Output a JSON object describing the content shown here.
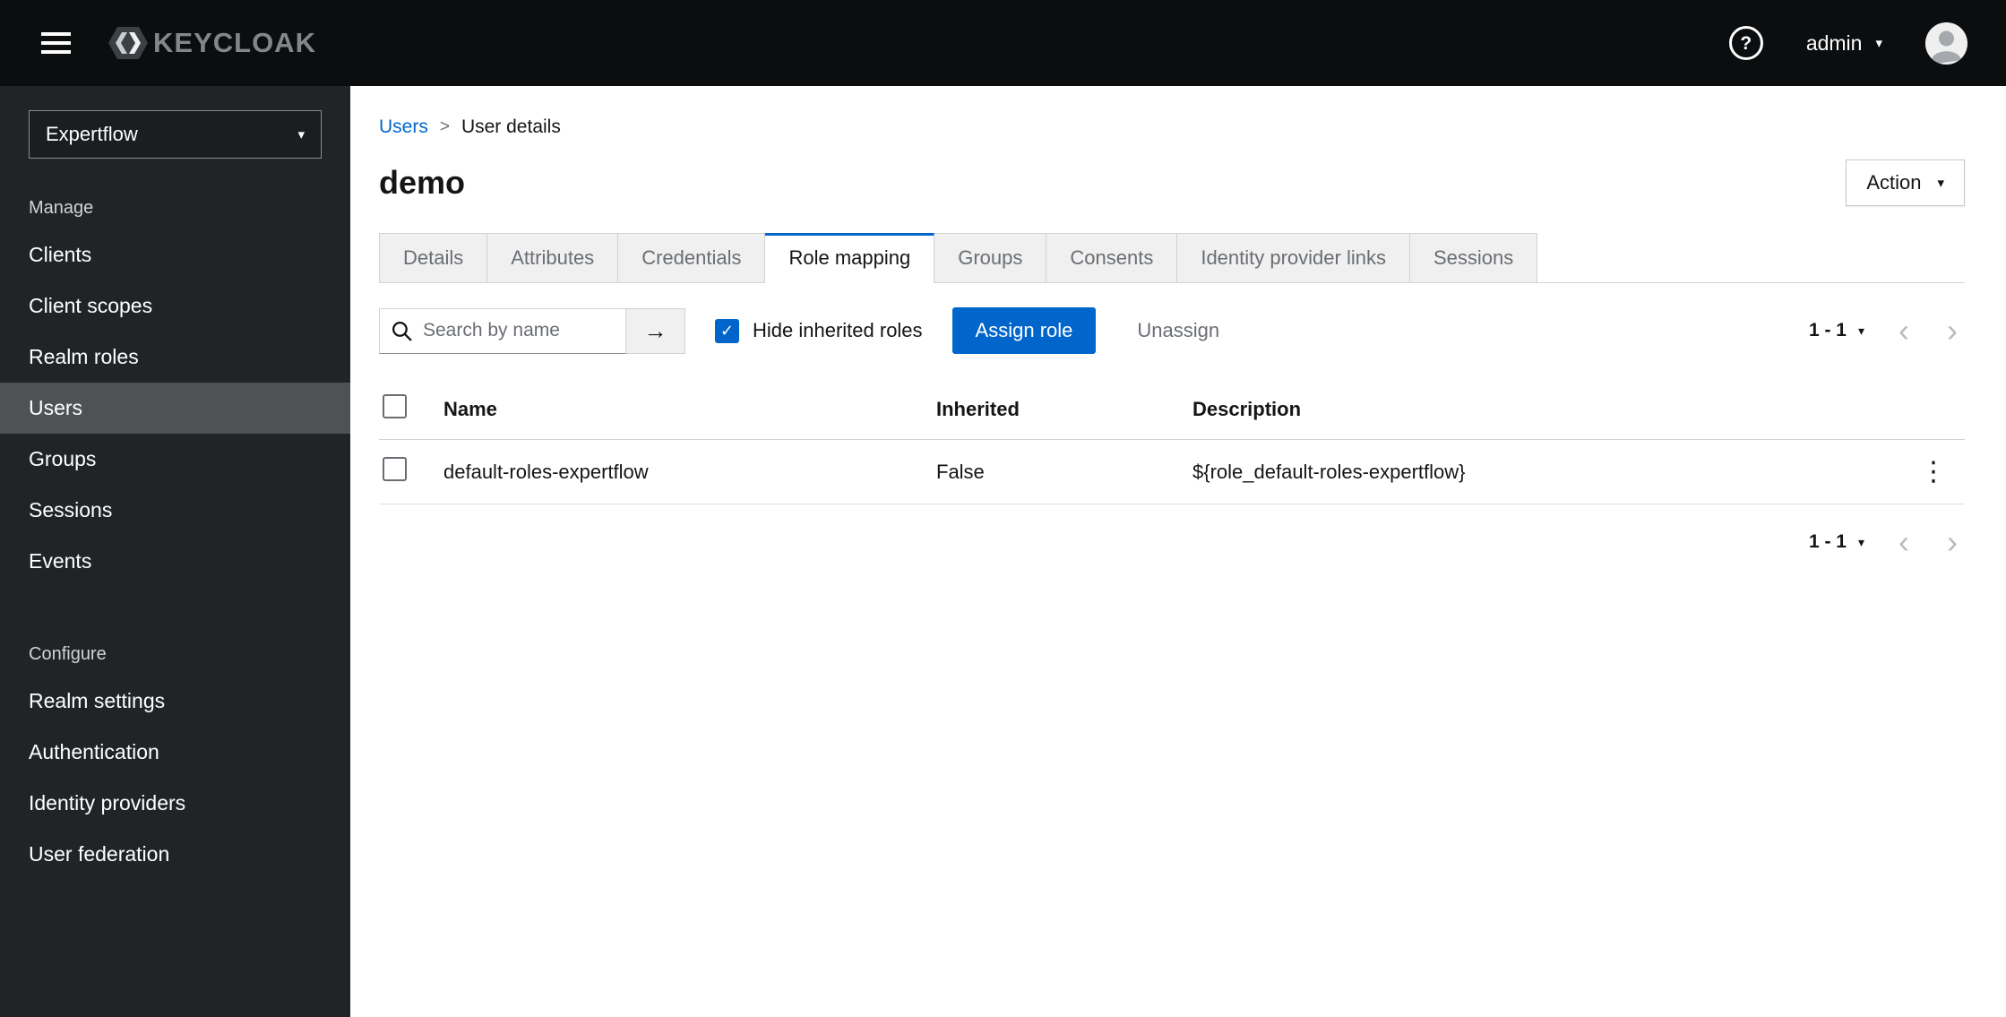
{
  "colors": {
    "primary": "#0066cc",
    "link": "#0066cc",
    "masthead_bg": "#0b0d0f",
    "sidebar_bg": "#212427",
    "active_nav_bg": "#4f5255",
    "active_tab_accent": "#0066cc"
  },
  "icons": {
    "hamburger": "css-bars",
    "caret": "▾",
    "help": "?",
    "arrow": "→",
    "check": "✓",
    "kebab": "⋮",
    "chevron_left": "‹",
    "chevron_right": "›",
    "breadcrumb_sep": ">"
  },
  "masthead": {
    "brand": "KEYCLOAK",
    "user": "admin"
  },
  "sidebar": {
    "realm": "Expertflow",
    "groups": [
      {
        "label": "Manage",
        "items": [
          {
            "label": "Clients"
          },
          {
            "label": "Client scopes"
          },
          {
            "label": "Realm roles"
          },
          {
            "label": "Users",
            "active": true
          },
          {
            "label": "Groups"
          },
          {
            "label": "Sessions"
          },
          {
            "label": "Events"
          }
        ]
      },
      {
        "label": "Configure",
        "items": [
          {
            "label": "Realm settings"
          },
          {
            "label": "Authentication"
          },
          {
            "label": "Identity providers"
          },
          {
            "label": "User federation"
          }
        ]
      }
    ]
  },
  "breadcrumb": {
    "link": "Users",
    "current": "User details"
  },
  "page": {
    "title": "demo",
    "action_label": "Action"
  },
  "tabs": [
    {
      "label": "Details"
    },
    {
      "label": "Attributes"
    },
    {
      "label": "Credentials"
    },
    {
      "label": "Role mapping",
      "active": true
    },
    {
      "label": "Groups"
    },
    {
      "label": "Consents"
    },
    {
      "label": "Identity provider links"
    },
    {
      "label": "Sessions"
    }
  ],
  "toolbar": {
    "search_placeholder": "Search by name",
    "hide_inherited_label": "Hide inherited roles",
    "assign_label": "Assign role",
    "unassign_label": "Unassign",
    "pagination_range": "1 - 1"
  },
  "table": {
    "headers": [
      "Name",
      "Inherited",
      "Description"
    ],
    "rows": [
      {
        "name": "default-roles-expertflow",
        "inherited": "False",
        "description": "${role_default-roles-expertflow}"
      }
    ]
  },
  "footer": {
    "pagination_range": "1 - 1"
  }
}
